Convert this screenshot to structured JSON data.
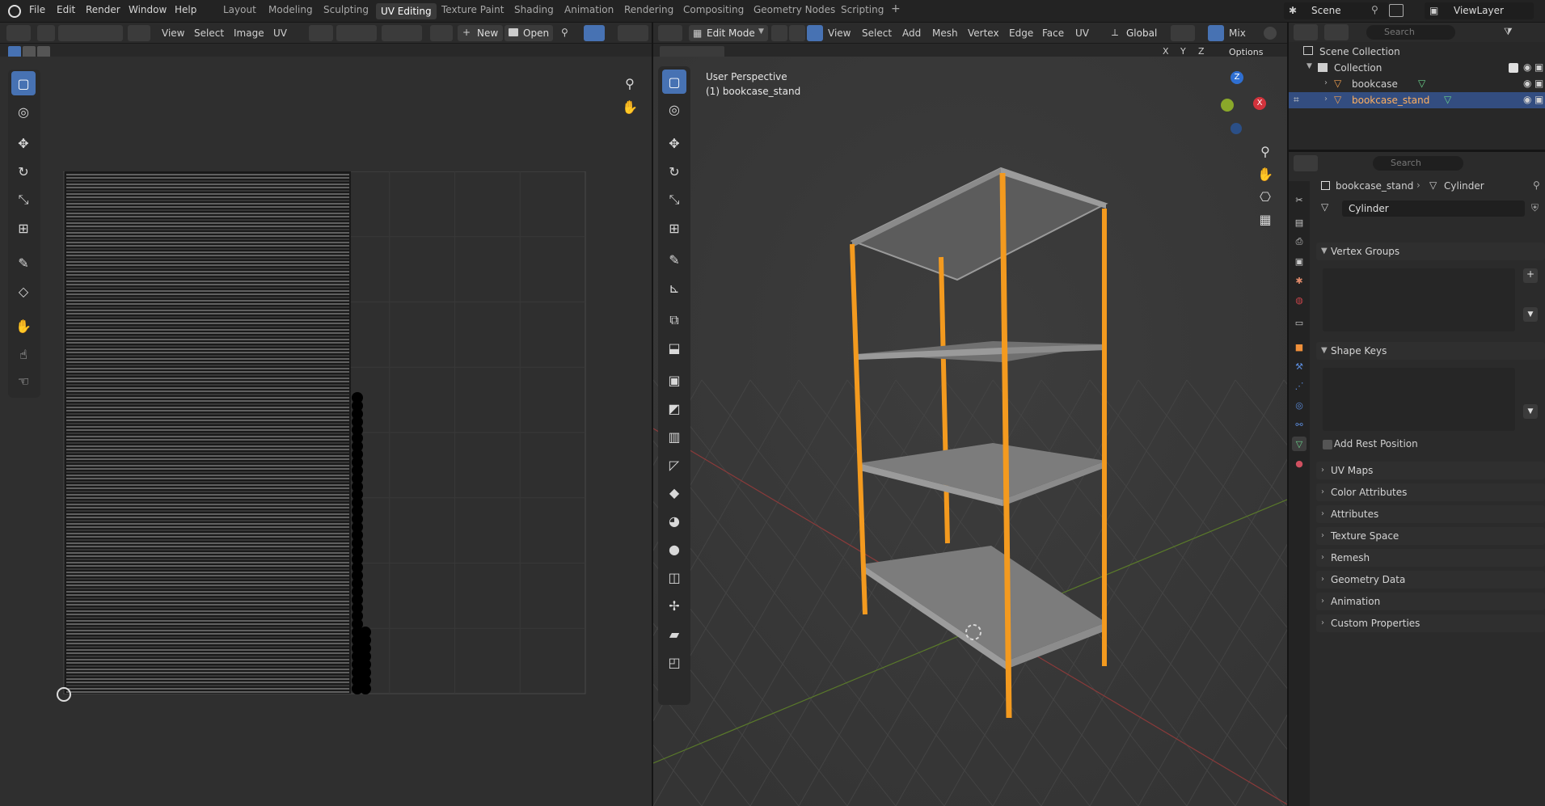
{
  "menu": {
    "file": "File",
    "edit": "Edit",
    "render": "Render",
    "window": "Window",
    "help": "Help"
  },
  "workspaces": [
    "Layout",
    "Modeling",
    "Sculpting",
    "UV Editing",
    "Texture Paint",
    "Shading",
    "Animation",
    "Rendering",
    "Compositing",
    "Geometry Nodes",
    "Scripting"
  ],
  "workspace_add": "+",
  "scene": {
    "label": "Scene",
    "view_layer": "ViewLayer"
  },
  "uv_editor": {
    "menus": [
      "View",
      "Select",
      "Image",
      "UV"
    ],
    "new_label": "New",
    "open_label": "Open"
  },
  "viewport": {
    "mode": "Edit Mode",
    "menus": [
      "View",
      "Select",
      "Add",
      "Mesh",
      "Vertex",
      "Edge",
      "Face",
      "UV"
    ],
    "orientation": "Global",
    "proportional": "Mix",
    "options_label": "Options",
    "axis_labels": [
      "X",
      "Y",
      "Z"
    ],
    "overlay_line1": "User Perspective",
    "overlay_line2": "(1) bookcase_stand",
    "gizmo_z": "Z",
    "gizmo_x": "X"
  },
  "outliner": {
    "search_placeholder": "Search",
    "scene_collection": "Scene Collection",
    "collection": "Collection",
    "items": [
      "bookcase",
      "bookcase_stand"
    ]
  },
  "properties": {
    "search_placeholder": "Search",
    "breadcrumb_object": "bookcase_stand",
    "breadcrumb_data": "Cylinder",
    "mesh_name": "Cylinder",
    "panels": {
      "vertex_groups": "Vertex Groups",
      "shape_keys": "Shape Keys",
      "add_rest_position": "Add Rest Position",
      "uv_maps": "UV Maps",
      "color_attributes": "Color Attributes",
      "attributes": "Attributes",
      "texture_space": "Texture Space",
      "remesh": "Remesh",
      "geometry_data": "Geometry Data",
      "animation": "Animation",
      "custom_properties": "Custom Properties"
    }
  },
  "colors": {
    "accent": "#4772b3",
    "selected_edge": "#ff9a1f",
    "shelf": "#8a8a8a",
    "outliner_sel": "#334d80"
  }
}
